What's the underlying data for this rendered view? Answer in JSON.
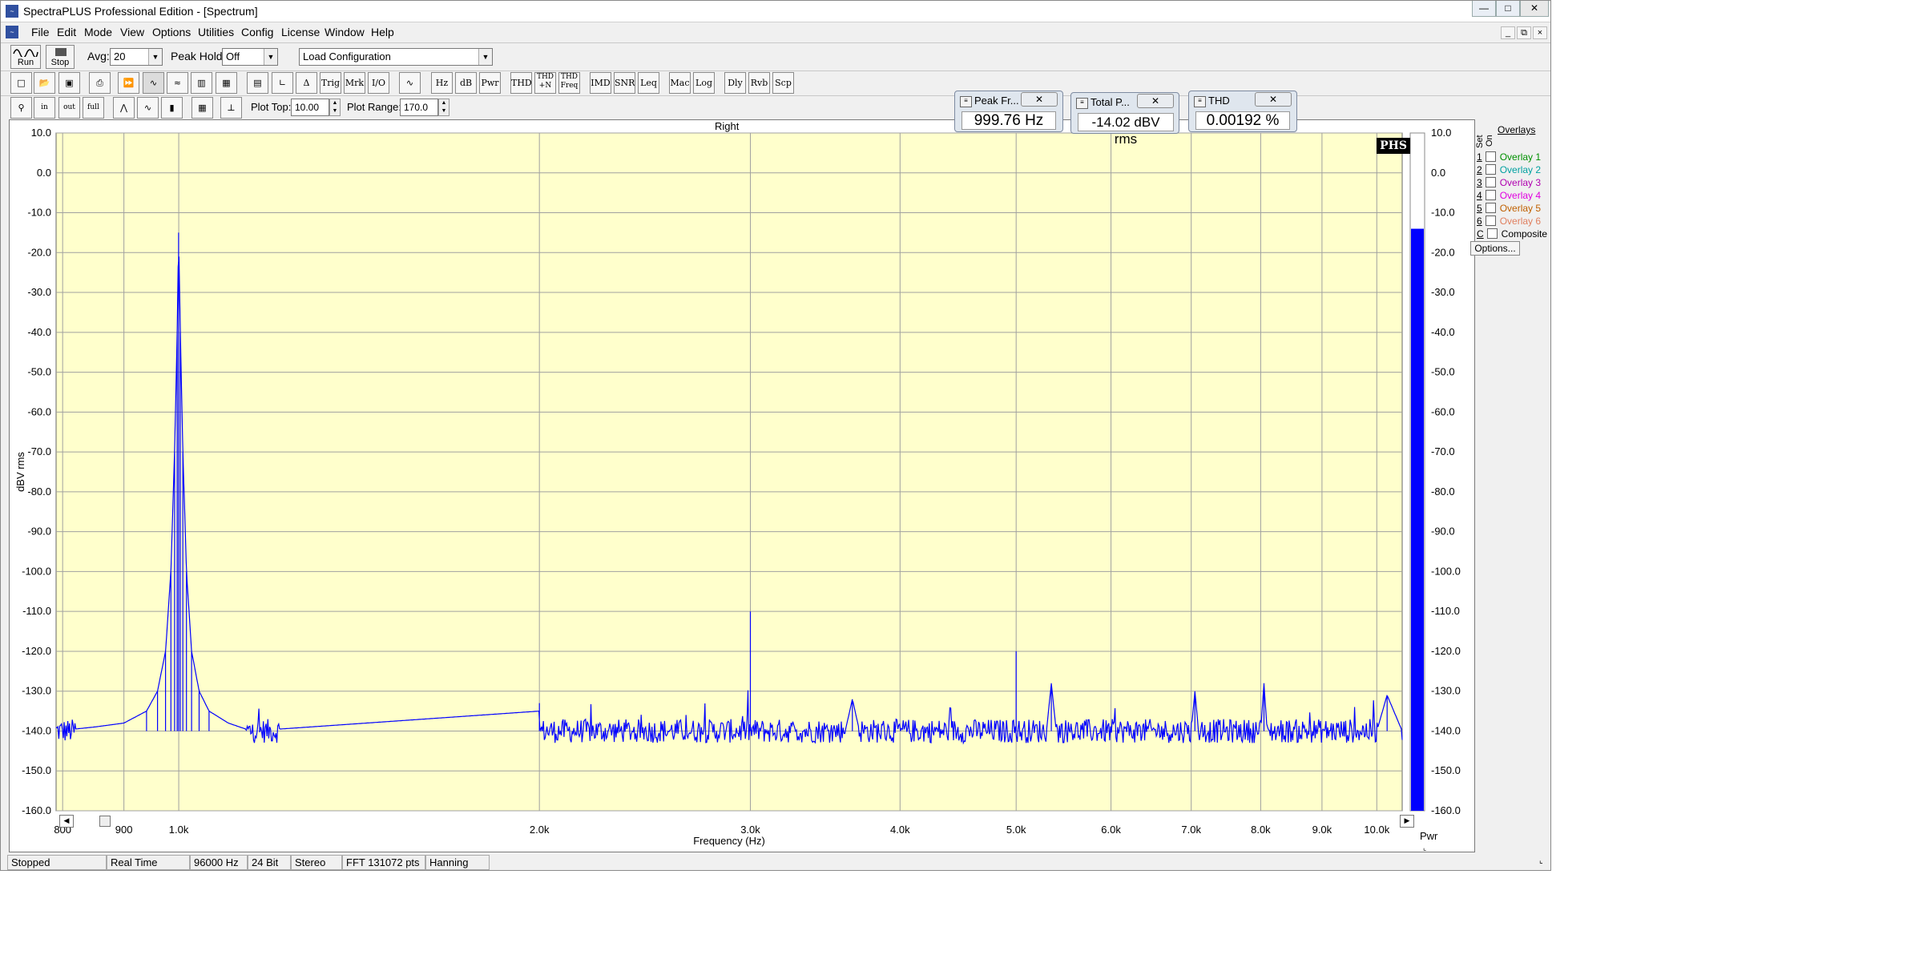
{
  "window": {
    "title": "SpectraPLUS Professional Edition - [Spectrum]",
    "app_icon": "spectrum-app-icon",
    "controls": [
      "minimize",
      "maximize",
      "close"
    ]
  },
  "menu": {
    "items": [
      "File",
      "Edit",
      "Mode",
      "View",
      "Options",
      "Utilities",
      "Config",
      "License",
      "Window",
      "Help"
    ]
  },
  "toolbar1": {
    "run_label": "Run",
    "stop_label": "Stop",
    "avg_label": "Avg:",
    "avg_value": "20",
    "peakhold_label": "Peak Hold:",
    "peakhold_value": "Off",
    "config_value": "Load Configuration"
  },
  "toolbar2": {
    "buttons": [
      "Trig",
      "Mrk",
      "I/O",
      "Hz",
      "dB",
      "Pwr",
      "THD",
      "THD +N",
      "THD Freq",
      "IMD",
      "SNR",
      "Leq",
      "Mac",
      "Log",
      "Dly",
      "Rvb",
      "Scp"
    ],
    "icons": [
      "new-file-icon",
      "open-file-icon",
      "save-icon",
      "print-icon",
      "fast-forward-icon",
      "spectrum-mode-icon",
      "waveform-icon",
      "spectrogram-icon",
      "3d-surface-icon",
      "calculator-icon",
      "axis-icon",
      "reference-icon",
      "generator-icon"
    ]
  },
  "toolbar3": {
    "plot_top_label": "Plot Top:",
    "plot_top_value": "10.00",
    "plot_range_label": "Plot Range:",
    "plot_range_value": "170.0",
    "icons": [
      "zoom-icon",
      "zoom-in-2x-icon",
      "zoom-out-2x-icon",
      "zoom-out-full-icon",
      "peak-icon",
      "smooth-icon",
      "bars-icon",
      "table-icon",
      "cursor-icon"
    ]
  },
  "meters": [
    {
      "title": "Peak Fr...",
      "value": "999.76 Hz"
    },
    {
      "title": "Total P...",
      "value": "-14.02 dBV rms"
    },
    {
      "title": "THD",
      "value": "0.00192 %"
    }
  ],
  "plot": {
    "channel": "Right",
    "logo": "PHS",
    "pwr_label": "Pwr",
    "scroll_left": "◀",
    "scroll_right": "▶"
  },
  "overlays": {
    "title": "Overlays",
    "set_label": "Set",
    "on_label": "On",
    "items": [
      {
        "key": "1",
        "label": "Overlay 1",
        "color": "#009000"
      },
      {
        "key": "2",
        "label": "Overlay 2",
        "color": "#00a0a0"
      },
      {
        "key": "3",
        "label": "Overlay 3",
        "color": "#b000b0"
      },
      {
        "key": "4",
        "label": "Overlay 4",
        "color": "#e000e0"
      },
      {
        "key": "5",
        "label": "Overlay 5",
        "color": "#c06000"
      },
      {
        "key": "6",
        "label": "Overlay 6",
        "color": "#e08060"
      },
      {
        "key": "C",
        "label": "Composite",
        "color": "#000000"
      }
    ],
    "options_label": "Options..."
  },
  "status": [
    "Stopped",
    "Real Time",
    "96000 Hz",
    "24 Bit",
    "Stereo",
    "FFT 131072 pts",
    "Hanning"
  ],
  "chart_data": {
    "type": "line",
    "title": "Right",
    "xlabel": "Frequency (Hz)",
    "ylabel": "dBV rms",
    "xscale": "log",
    "xlim": [
      790,
      10500
    ],
    "ylim": [
      -160,
      10
    ],
    "yticks": [
      "10.0",
      "0.0",
      "-10.0",
      "-20.0",
      "-30.0",
      "-40.0",
      "-50.0",
      "-60.0",
      "-70.0",
      "-80.0",
      "-90.0",
      "-100.0",
      "-110.0",
      "-120.0",
      "-130.0",
      "-140.0",
      "-150.0",
      "-160.0"
    ],
    "xticks": [
      {
        "v": 800,
        "label": "800"
      },
      {
        "v": 900,
        "label": "900"
      },
      {
        "v": 1000,
        "label": "1.0k"
      },
      {
        "v": 2000,
        "label": "2.0k"
      },
      {
        "v": 3000,
        "label": "3.0k"
      },
      {
        "v": 4000,
        "label": "4.0k"
      },
      {
        "v": 5000,
        "label": "5.0k"
      },
      {
        "v": 6000,
        "label": "6.0k"
      },
      {
        "v": 7000,
        "label": "7.0k"
      },
      {
        "v": 8000,
        "label": "8.0k"
      },
      {
        "v": 9000,
        "label": "9.0k"
      },
      {
        "v": 10000,
        "label": "10.0k"
      }
    ],
    "noise_floor_db": -140,
    "series": [
      {
        "color": "#0000ff",
        "points": [
          [
            790,
            -140
          ],
          [
            850,
            -139
          ],
          [
            900,
            -138
          ],
          [
            940,
            -135
          ],
          [
            960,
            -130
          ],
          [
            975,
            -120
          ],
          [
            985,
            -100
          ],
          [
            992,
            -70
          ],
          [
            997,
            -40
          ],
          [
            999.8,
            -15
          ],
          [
            1003,
            -40
          ],
          [
            1008,
            -70
          ],
          [
            1015,
            -100
          ],
          [
            1025,
            -120
          ],
          [
            1040,
            -130
          ],
          [
            1060,
            -135
          ],
          [
            1100,
            -138
          ],
          [
            1150,
            -140
          ],
          [
            2000,
            -135
          ],
          [
            2000,
            -133
          ],
          [
            2000,
            -140
          ],
          [
            3000,
            -140
          ],
          [
            3000,
            -110
          ],
          [
            3000,
            -140
          ],
          [
            3600,
            -140
          ],
          [
            3650,
            -132
          ],
          [
            3700,
            -140
          ],
          [
            5000,
            -140
          ],
          [
            5000,
            -120
          ],
          [
            5000,
            -140
          ],
          [
            5300,
            -140
          ],
          [
            5350,
            -128
          ],
          [
            5400,
            -140
          ],
          [
            7000,
            -140
          ],
          [
            7050,
            -130
          ],
          [
            7100,
            -140
          ],
          [
            8000,
            -140
          ],
          [
            8050,
            -128
          ],
          [
            8100,
            -140
          ],
          [
            10000,
            -140
          ],
          [
            10200,
            -131
          ],
          [
            10500,
            -140
          ]
        ]
      }
    ],
    "pwr_meter": {
      "value_db": -14.02,
      "range": [
        -160,
        10
      ]
    }
  },
  "colors": {
    "plot_bg": "#ffffcc",
    "grid": "#a0a0a0",
    "trace": "#0000ff",
    "pwr_bar": "#0000ff"
  }
}
